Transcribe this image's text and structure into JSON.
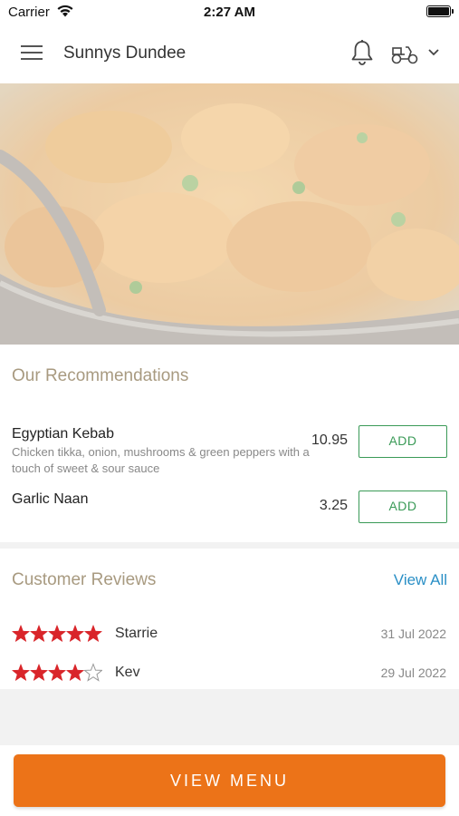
{
  "status_bar": {
    "carrier": "Carrier",
    "time": "2:27 AM"
  },
  "header": {
    "store_name": "Sunnys Dundee",
    "menu_icon": "hamburger-icon",
    "notification_icon": "bell-icon",
    "order_mode_icon": "delivery-scooter-icon",
    "dropdown_icon": "chevron-down-icon"
  },
  "hero": {
    "image": "curry-dish-photo"
  },
  "recommendations": {
    "title": "Our Recommendations",
    "items": [
      {
        "name": "Egyptian Kebab",
        "description": "Chicken tikka, onion, mushrooms & green peppers with a touch of sweet & sour sauce",
        "price": "10.95",
        "button": "ADD"
      },
      {
        "name": "Garlic Naan",
        "description": "",
        "price": "3.25",
        "button": "ADD"
      }
    ]
  },
  "reviews": {
    "title": "Customer Reviews",
    "view_all": "View All",
    "items": [
      {
        "rating": 5,
        "name": "Starrie",
        "date": "31 Jul 2022"
      },
      {
        "rating": 4,
        "name": "Kev",
        "date": "29 Jul 2022"
      }
    ]
  },
  "cta": {
    "label": "VIEW MENU"
  },
  "colors": {
    "accent_orange": "#ec7318",
    "add_green": "#3a9a57",
    "star_red": "#d9252a",
    "link_blue": "#2a8fc6",
    "section_title": "#a89a80"
  }
}
